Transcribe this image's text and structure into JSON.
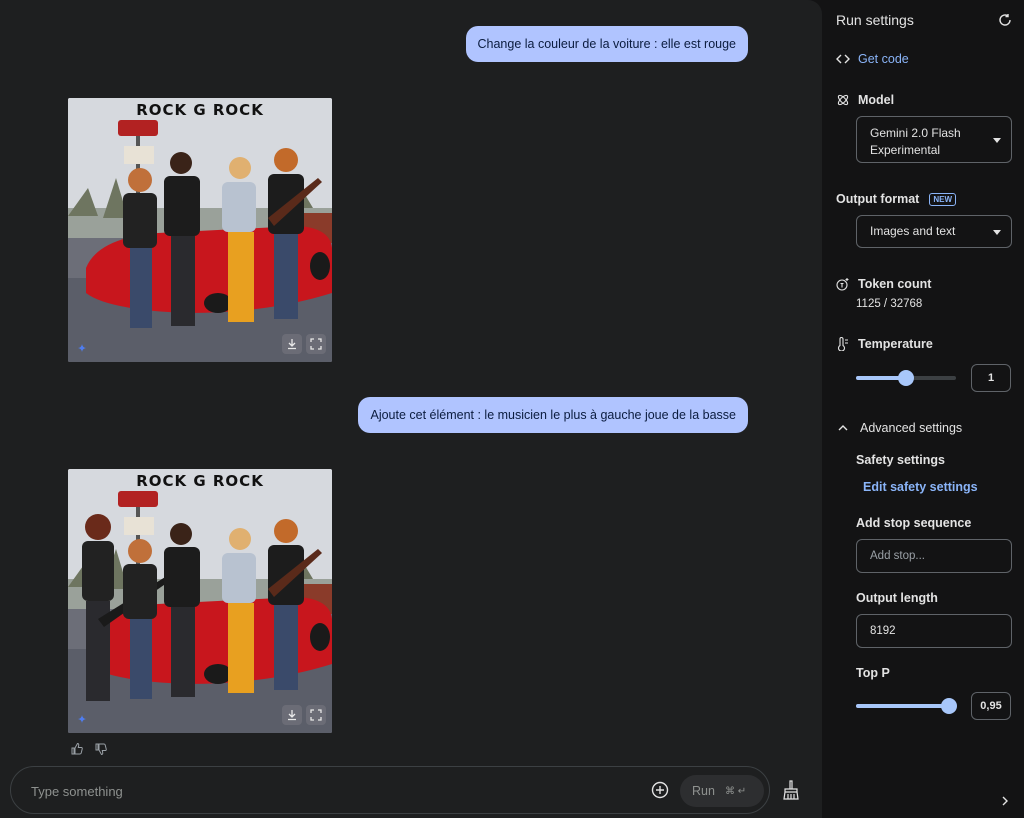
{
  "chat": {
    "messages": [
      {
        "role": "user",
        "text": "Change la couleur de la voiture : elle est rouge"
      },
      {
        "role": "model",
        "image_title": "ROCK G ROCK",
        "image_sign": "MOTEL"
      },
      {
        "role": "user",
        "text": "Ajoute cet élément : le musicien le plus à gauche joue de la basse"
      },
      {
        "role": "model",
        "image_title": "ROCK G ROCK",
        "image_sign": "MOTEL"
      }
    ],
    "image_actions": {
      "download_icon": "download-icon",
      "fullscreen_icon": "fullscreen-icon"
    },
    "feedback": {
      "up_icon": "thumb-up-icon",
      "down_icon": "thumb-down-icon"
    }
  },
  "composer": {
    "placeholder": "Type something",
    "run_label": "Run",
    "run_shortcut": "⌘ ↵",
    "add_icon": "add-circle-icon",
    "clear_icon": "broom-icon"
  },
  "settings": {
    "title": "Run settings",
    "get_code": "Get code",
    "model_label": "Model",
    "model_value": "Gemini 2.0 Flash Experimental",
    "output_format_label": "Output format",
    "new_badge": "NEW",
    "output_format_value": "Images and text",
    "token_count_label": "Token count",
    "token_count_value": "1125 / 32768",
    "temperature_label": "Temperature",
    "temperature_value": "1",
    "temperature_fraction": 0.5,
    "advanced_label": "Advanced settings",
    "safety_label": "Safety settings",
    "safety_link": "Edit safety settings",
    "stop_label": "Add stop sequence",
    "stop_placeholder": "Add stop...",
    "output_length_label": "Output length",
    "output_length_value": "8192",
    "top_p_label": "Top P",
    "top_p_value": "0,95",
    "top_p_fraction": 0.95
  },
  "colors": {
    "accent": "#a8c7fa",
    "link": "#8ab4f8",
    "user_bubble": "#b0c4ff",
    "car_red": "#c8161d"
  }
}
